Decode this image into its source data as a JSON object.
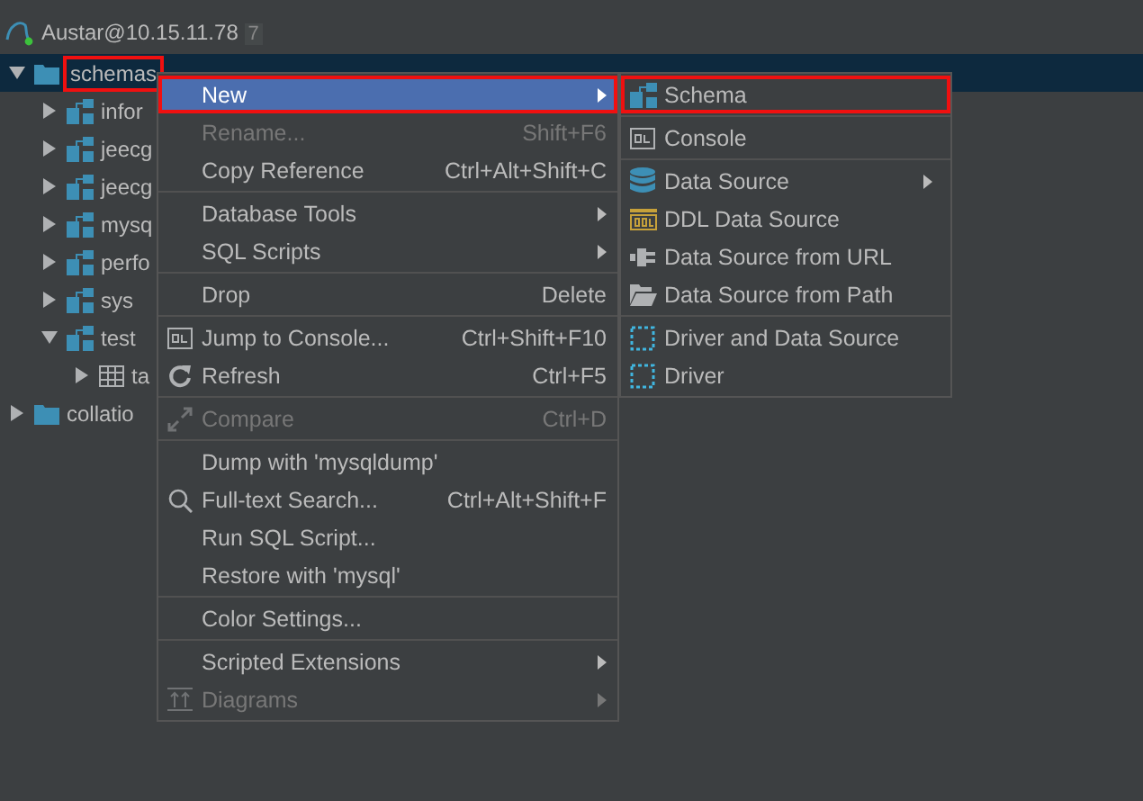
{
  "connection": {
    "label": "Austar@10.15.11.78",
    "count": "7",
    "children": [
      {
        "label": "schemas",
        "kind": "folder",
        "expanded": true,
        "selected": true,
        "annotated": true,
        "children": [
          {
            "label": "infor",
            "kind": "schema",
            "expanded": false,
            "selected": false
          },
          {
            "label": "jeecg",
            "kind": "schema",
            "expanded": false,
            "selected": false
          },
          {
            "label": "jeecg",
            "kind": "schema",
            "expanded": false,
            "selected": false
          },
          {
            "label": "mysq",
            "kind": "schema",
            "expanded": false,
            "selected": false
          },
          {
            "label": "perfo",
            "kind": "schema",
            "expanded": false,
            "selected": false
          },
          {
            "label": "sys",
            "kind": "schema",
            "expanded": false,
            "selected": false
          },
          {
            "label": "test",
            "kind": "schema",
            "expanded": true,
            "selected": false,
            "children": [
              {
                "label": "ta",
                "kind": "table",
                "expanded": false,
                "selected": false
              }
            ]
          }
        ]
      },
      {
        "label": "collatio",
        "kind": "folder",
        "expanded": false,
        "selected": false
      }
    ]
  },
  "context_menu": {
    "groups": [
      [
        {
          "label": "New",
          "submenu": true,
          "selected": true,
          "disabled": false,
          "annotated": true
        },
        {
          "label": "Rename...",
          "shortcut": "Shift+F6",
          "selected": false,
          "disabled": true
        },
        {
          "label": "Copy Reference",
          "shortcut": "Ctrl+Alt+Shift+C",
          "selected": false,
          "disabled": false
        }
      ],
      [
        {
          "label": "Database Tools",
          "submenu": true,
          "selected": false,
          "disabled": false
        },
        {
          "label": "SQL Scripts",
          "submenu": true,
          "selected": false,
          "disabled": false
        }
      ],
      [
        {
          "label": "Drop",
          "shortcut": "Delete",
          "selected": false,
          "disabled": false
        }
      ],
      [
        {
          "label": "Jump to Console...",
          "shortcut": "Ctrl+Shift+F10",
          "kind": "console",
          "selected": false,
          "disabled": false
        },
        {
          "label": "Refresh",
          "shortcut": "Ctrl+F5",
          "kind": "refresh",
          "selected": false,
          "disabled": false
        }
      ],
      [
        {
          "label": "Compare",
          "shortcut": "Ctrl+D",
          "kind": "compare",
          "selected": false,
          "disabled": true
        }
      ],
      [
        {
          "label": "Dump with 'mysqldump'",
          "selected": false,
          "disabled": false
        },
        {
          "label": "Full-text Search...",
          "shortcut": "Ctrl+Alt+Shift+F",
          "kind": "search",
          "selected": false,
          "disabled": false
        },
        {
          "label": "Run SQL Script...",
          "selected": false,
          "disabled": false
        },
        {
          "label": "Restore with 'mysql'",
          "selected": false,
          "disabled": false
        }
      ],
      [
        {
          "label": "Color Settings...",
          "selected": false,
          "disabled": false
        }
      ],
      [
        {
          "label": "Scripted Extensions",
          "submenu": true,
          "selected": false,
          "disabled": false
        },
        {
          "label": "Diagrams",
          "submenu": true,
          "kind": "diagram",
          "selected": false,
          "disabled": true
        }
      ]
    ]
  },
  "new_submenu": {
    "groups": [
      [
        {
          "label": "Schema",
          "kind": "schema",
          "selected": false,
          "disabled": false,
          "annotated": true
        }
      ],
      [
        {
          "label": "Console",
          "kind": "console",
          "selected": false,
          "disabled": false
        }
      ],
      [
        {
          "label": "Data Source",
          "kind": "database",
          "submenu": true,
          "selected": false,
          "disabled": false
        },
        {
          "label": "DDL Data Source",
          "kind": "ddl",
          "selected": false,
          "disabled": false
        },
        {
          "label": "Data Source from URL",
          "kind": "plug",
          "selected": false,
          "disabled": false
        },
        {
          "label": "Data Source from Path",
          "kind": "folder-open",
          "selected": false,
          "disabled": false
        }
      ],
      [
        {
          "label": "Driver and Data Source",
          "kind": "driver",
          "selected": false,
          "disabled": false
        },
        {
          "label": "Driver",
          "kind": "driver",
          "selected": false,
          "disabled": false
        }
      ]
    ]
  }
}
